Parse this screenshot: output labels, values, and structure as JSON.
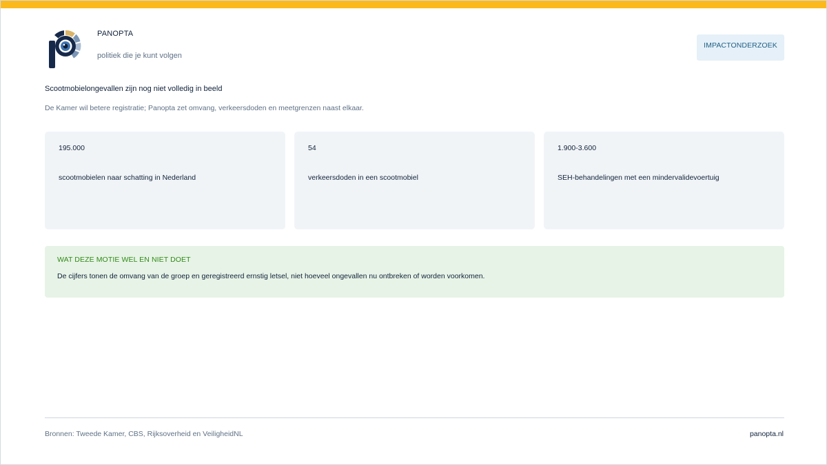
{
  "header": {
    "brand": "PANOPTA",
    "tagline": "politiek die je kunt volgen",
    "impact_button": "IMPACTONDERZOEK"
  },
  "colors": {
    "accent_bar": "#fbb91c",
    "logo_dark": "#16294a",
    "logo_gold": "#d9b469",
    "logo_blue": "#7c97b5",
    "positive_green": "#2f8a16"
  },
  "main": {
    "headline": "Scootmobielongevallen zijn nog niet volledig in beeld",
    "subline": "De Kamer wil betere registratie; Panopta zet omvang, verkeersdoden en meetgrenzen naast elkaar.",
    "stats": [
      {
        "value": "195.000",
        "label": "scootmobielen naar schatting in Nederland"
      },
      {
        "value": "54",
        "label": "verkeersdoden in een scootmobiel"
      },
      {
        "value": "1.900-3.600",
        "label": "SEH-behandelingen met een mindervalidevoertuig"
      }
    ],
    "motion_note": {
      "title": "WAT DEZE MOTIE WEL EN NIET DOET",
      "text": "De cijfers tonen de omvang van de groep en geregistreerd ernstig letsel, niet hoeveel ongevallen nu ontbreken of worden voorkomen."
    }
  },
  "footer": {
    "sources": "Bronnen: Tweede Kamer, CBS, Rijksoverheid en VeiligheidNL",
    "site": "panopta.nl"
  }
}
